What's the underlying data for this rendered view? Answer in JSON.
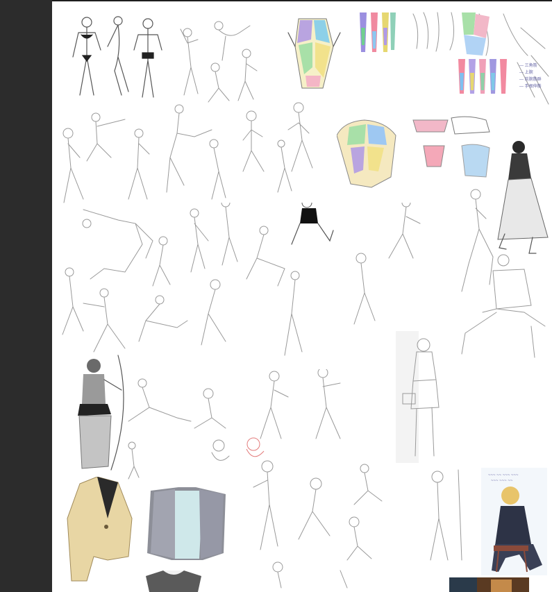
{
  "app": {
    "sidebar_color": "#2c2c2c",
    "canvas_color": "#ffffff"
  },
  "board": {
    "items": [
      {
        "name": "swimsuit-figure-poses"
      },
      {
        "name": "gesture-pose-sketches"
      },
      {
        "name": "torso-muscle-anatomy-chart"
      },
      {
        "name": "arm-muscle-anatomy-chart"
      },
      {
        "name": "action-pose-sketches"
      },
      {
        "name": "chest-back-anatomy-chart"
      },
      {
        "name": "seated-woman-dress-illustration"
      },
      {
        "name": "dynamic-pose-sheet"
      },
      {
        "name": "casual-seated-man-sketch"
      },
      {
        "name": "archer-figure-render"
      },
      {
        "name": "character-pose-sketches"
      },
      {
        "name": "schoolgirl-standing-sketch"
      },
      {
        "name": "cropped-jacket-render"
      },
      {
        "name": "hoodie-render"
      },
      {
        "name": "anime-girl-pose-sketches"
      },
      {
        "name": "blonde-character-chair-illustration"
      },
      {
        "name": "tshirt-render"
      },
      {
        "name": "painted-interior-thumbnail"
      }
    ]
  },
  "notes": {
    "muscle_note_lines": [
      "— 三角筋",
      "— 上腕",
      "— 前腕筋群",
      "— 手根伸筋"
    ],
    "illustration_caption": [
      "~~~ ~~ ~~~ ~~~",
      "~~~ ~~~ ~~"
    ]
  }
}
